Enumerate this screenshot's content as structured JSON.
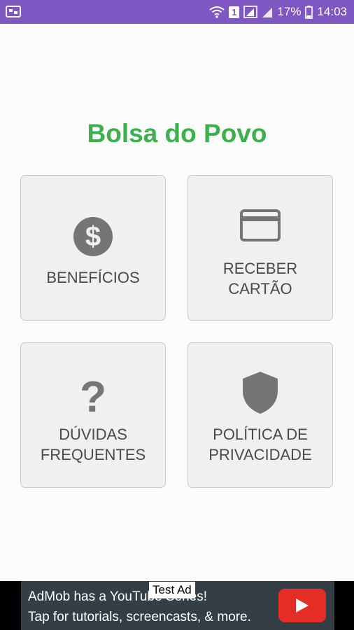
{
  "status_bar": {
    "battery_percent": "17%",
    "time": "14:03",
    "sim_badge": "1",
    "icons": [
      "screenshot-icon",
      "wifi-icon",
      "signal-icon",
      "battery-icon"
    ]
  },
  "app": {
    "title": "Bolsa do Povo",
    "title_color": "#3cb04a"
  },
  "tiles": [
    {
      "label": "BENEFÍCIOS",
      "icon": "dollar-coin-icon"
    },
    {
      "label": "RECEBER\nCARTÃO",
      "icon": "credit-card-icon"
    },
    {
      "label": "DÚVIDAS\nFREQUENTES",
      "icon": "question-mark-icon"
    },
    {
      "label": "POLÍTICA DE\nPRIVACIDADE",
      "icon": "shield-icon"
    }
  ],
  "ad": {
    "label": "Test Ad",
    "line1": "AdMob has a YouTube Series!",
    "line2": "Tap for tutorials, screencasts, & more.",
    "icon": "youtube-play-icon"
  },
  "colors": {
    "status_bar": "#7e57c2",
    "tile_bg": "#f0f0f0",
    "icon_gray": "#757575",
    "ad_bg": "#333f44",
    "youtube_red": "#e52d27"
  }
}
